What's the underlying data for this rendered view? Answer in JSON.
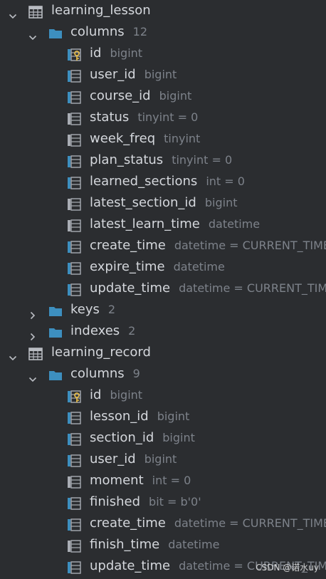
{
  "tables": [
    {
      "name": "learning_lesson",
      "columns_label": "columns",
      "columns_count": "12",
      "columns": [
        {
          "name": "id",
          "type": "bigint",
          "icon": "primary-key-column-icon"
        },
        {
          "name": "user_id",
          "type": "bigint",
          "icon": "index-column-icon"
        },
        {
          "name": "course_id",
          "type": "bigint",
          "icon": "index-column-icon"
        },
        {
          "name": "status",
          "type": "tinyint = 0",
          "icon": "column-icon"
        },
        {
          "name": "week_freq",
          "type": "tinyint",
          "icon": "column-icon"
        },
        {
          "name": "plan_status",
          "type": "tinyint = 0",
          "icon": "index-column-icon"
        },
        {
          "name": "learned_sections",
          "type": "int = 0",
          "icon": "index-column-icon"
        },
        {
          "name": "latest_section_id",
          "type": "bigint",
          "icon": "column-icon"
        },
        {
          "name": "latest_learn_time",
          "type": "datetime",
          "icon": "column-icon"
        },
        {
          "name": "create_time",
          "type": "datetime = CURRENT_TIMES",
          "icon": "index-column-icon"
        },
        {
          "name": "expire_time",
          "type": "datetime",
          "icon": "index-column-icon"
        },
        {
          "name": "update_time",
          "type": "datetime = CURRENT_TIME",
          "icon": "index-column-icon"
        }
      ],
      "keys_label": "keys",
      "keys_count": "2",
      "indexes_label": "indexes",
      "indexes_count": "2"
    },
    {
      "name": "learning_record",
      "columns_label": "columns",
      "columns_count": "9",
      "columns": [
        {
          "name": "id",
          "type": "bigint",
          "icon": "primary-key-column-icon"
        },
        {
          "name": "lesson_id",
          "type": "bigint",
          "icon": "index-column-icon"
        },
        {
          "name": "section_id",
          "type": "bigint",
          "icon": "index-column-icon"
        },
        {
          "name": "user_id",
          "type": "bigint",
          "icon": "index-column-icon"
        },
        {
          "name": "moment",
          "type": "int = 0",
          "icon": "column-icon"
        },
        {
          "name": "finished",
          "type": "bit = b'0'",
          "icon": "index-column-icon"
        },
        {
          "name": "create_time",
          "type": "datetime = CURRENT_TIMES",
          "icon": "index-column-icon"
        },
        {
          "name": "finish_time",
          "type": "datetime",
          "icon": "column-icon"
        },
        {
          "name": "update_time",
          "type": "datetime = CURRENT_TIME",
          "icon": "index-column-icon"
        }
      ]
    }
  ],
  "watermark": "CSDN @诺水uy",
  "colors": {
    "background": "#2b2d30",
    "text": "#d4d7dc",
    "muted": "#7d828a",
    "folder": "#3d8fbf",
    "key": "#e0b84a"
  }
}
